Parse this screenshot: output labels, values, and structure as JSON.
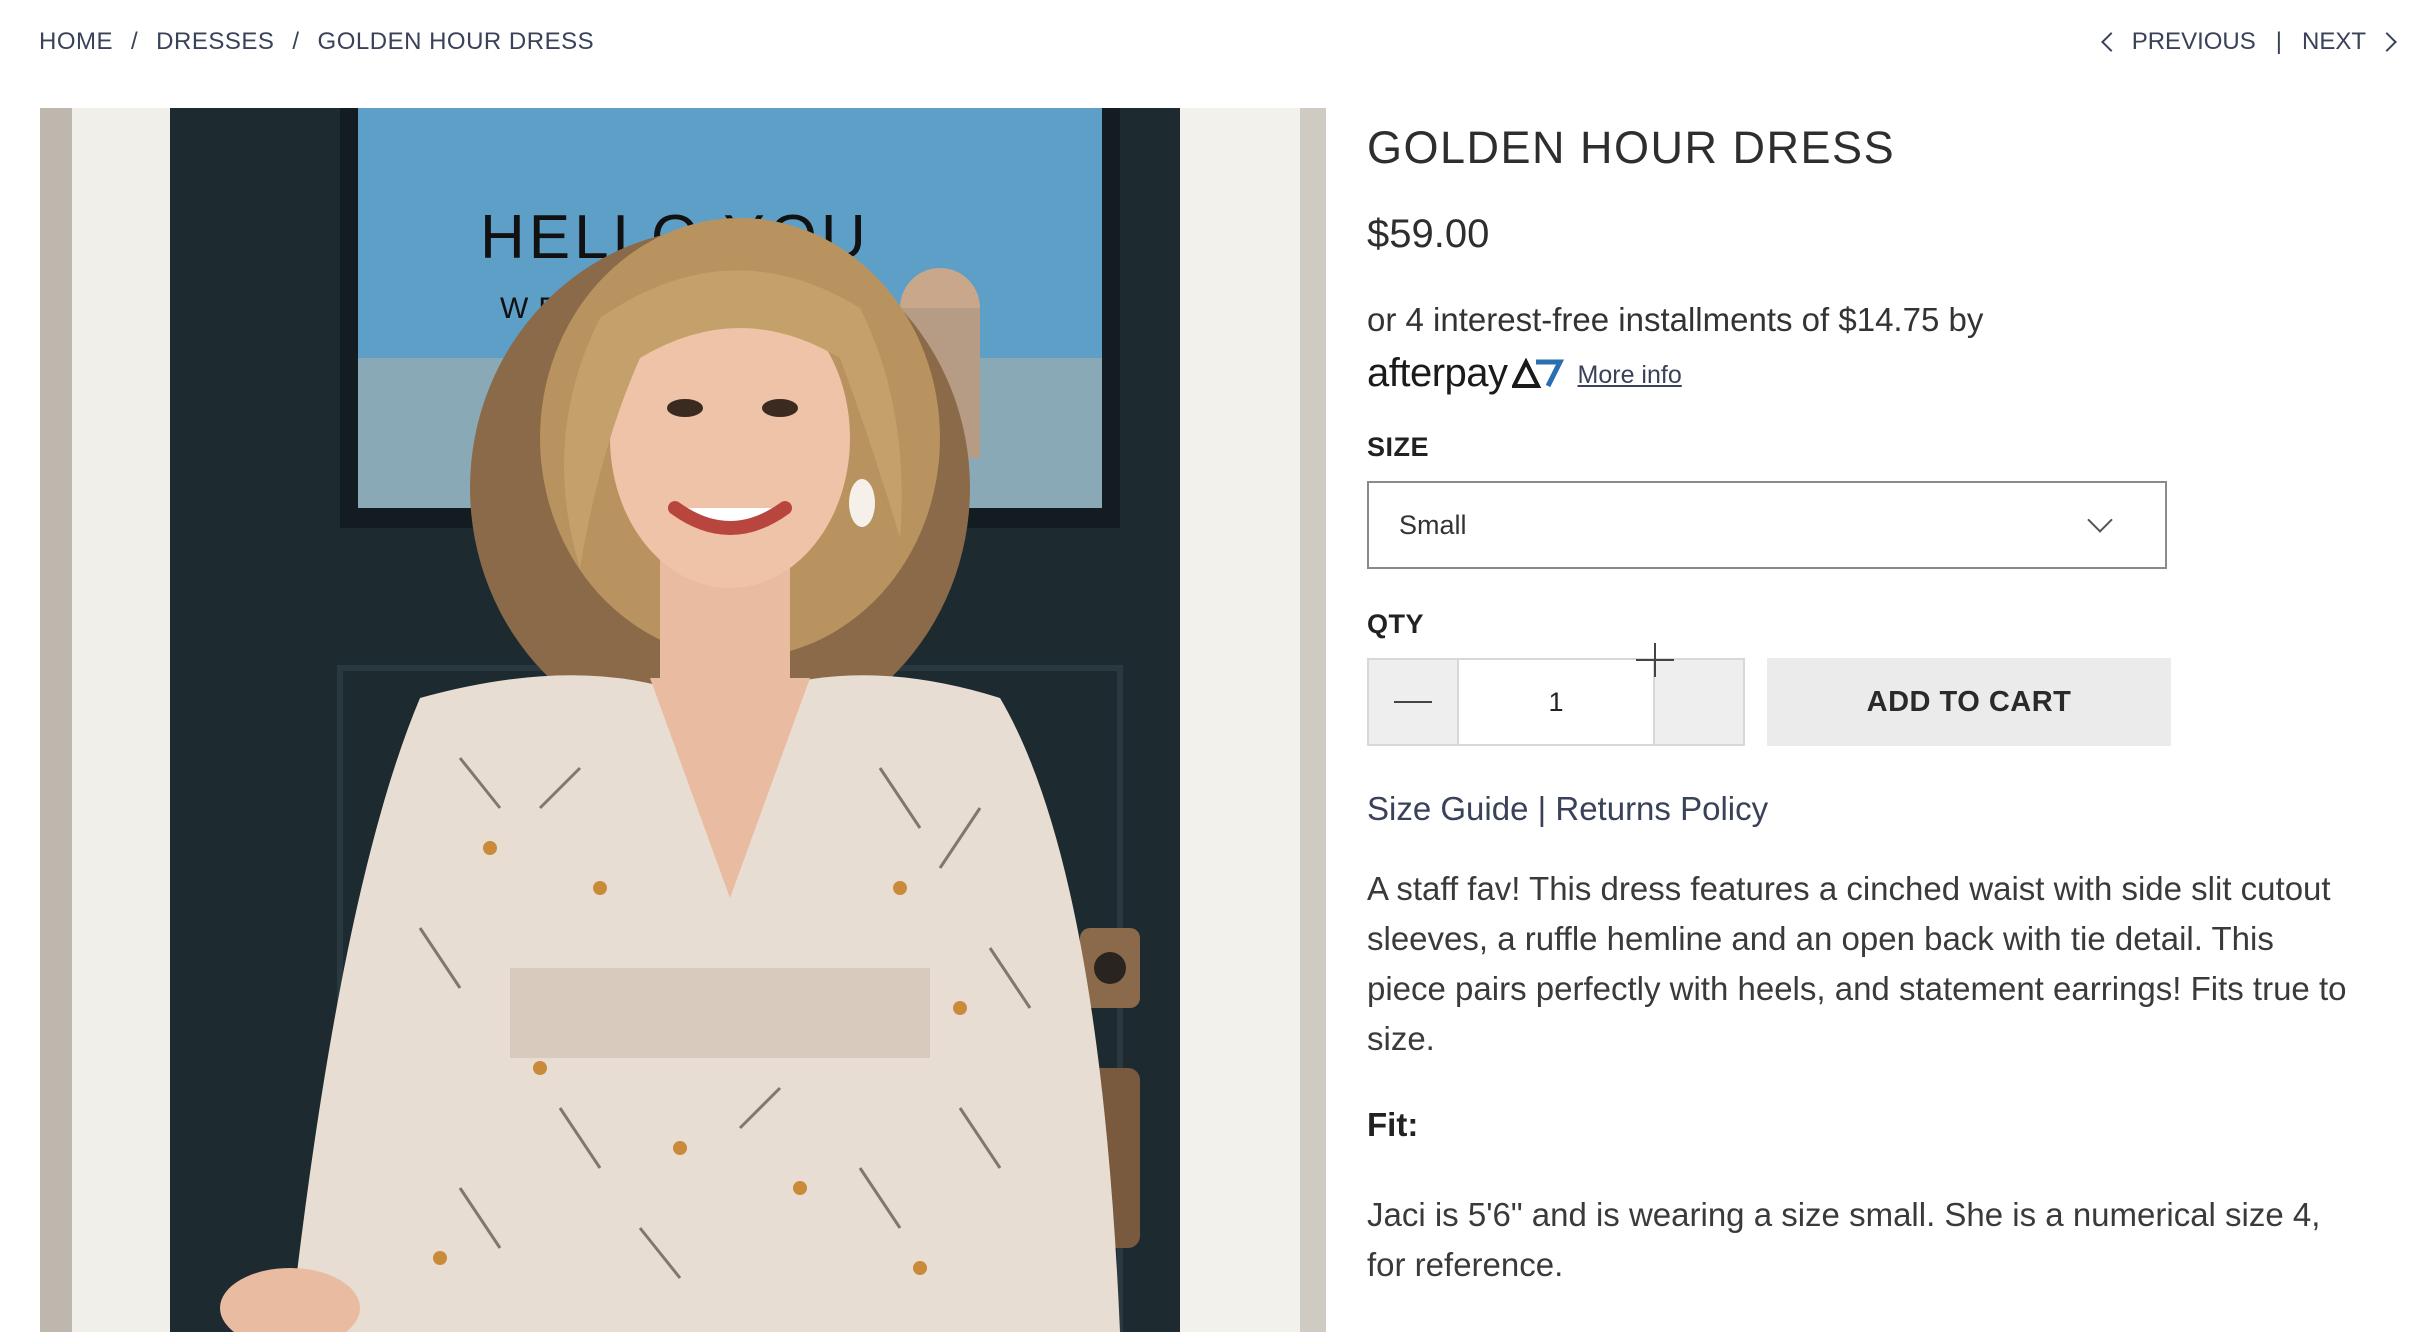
{
  "breadcrumb": {
    "home": "HOME",
    "category": "DRESSES",
    "current": "GOLDEN HOUR DRESS",
    "separator": "/"
  },
  "pager": {
    "previous": "PREVIOUS",
    "next": "NEXT",
    "divider": "|"
  },
  "product": {
    "title": "GOLDEN HOUR DRESS",
    "price": "$59.00",
    "installments_text": "or 4 interest-free installments of $14.75 by",
    "afterpay_brand": "afterpay",
    "more_info": "More info",
    "size_label": "SIZE",
    "size_selected": "Small",
    "qty_label": "QTY",
    "qty_value": "1",
    "add_to_cart": "ADD TO CART",
    "size_guide": "Size Guide",
    "links_divider": "|",
    "returns_policy": "Returns Policy",
    "description": "A staff fav! This dress features a cinched waist with side slit cutout sleeves, a ruffle hemline and an open back with tie detail. This piece pairs perfectly with heels, and statement earrings! Fits true to size.",
    "fit_label": "Fit:",
    "fit_text": "Jaci is 5'6\" and is wearing a size small.  She is a numerical size 4, for reference."
  },
  "photo": {
    "sign_line1": "HELLO YOU",
    "sign_line2": "WE"
  },
  "colors": {
    "link_navy": "#3a4259",
    "button_gray": "#ebebeb",
    "afterpay_mint": "#b2fce4",
    "door_dark": "#1d2a30"
  },
  "icons": {
    "prev": "chevron-left-icon",
    "next": "chevron-right-icon",
    "select": "chevron-down-icon",
    "minus": "minus-icon",
    "plus": "plus-icon",
    "afterpay": "afterpay-logo-icon"
  }
}
